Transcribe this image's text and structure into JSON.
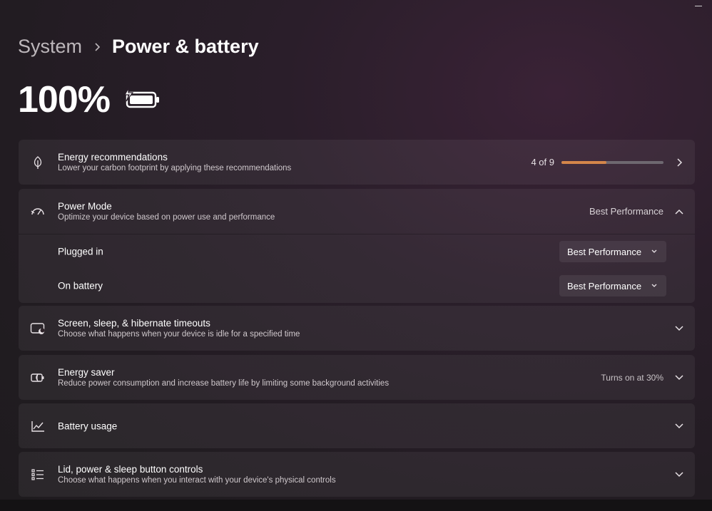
{
  "breadcrumb": {
    "parent": "System",
    "current": "Power & battery"
  },
  "battery": {
    "percent_label": "100%",
    "icon": "battery-charging-icon"
  },
  "energy_recommendations": {
    "title": "Energy recommendations",
    "desc": "Lower your carbon footprint by applying these recommendations",
    "progress_label": "4 of 9",
    "progress_fraction": 0.444,
    "accent": "#d4864a",
    "icon": "leaf-icon"
  },
  "power_mode": {
    "title": "Power Mode",
    "desc": "Optimize your device based on power use and performance",
    "value": "Best Performance",
    "icon": "speedometer-icon",
    "plugged_in": {
      "label": "Plugged in",
      "value": "Best Performance"
    },
    "on_battery": {
      "label": "On battery",
      "value": "Best Performance"
    }
  },
  "screen_sleep": {
    "title": "Screen, sleep, & hibernate timeouts",
    "desc": "Choose what happens when your device is idle for a specified time",
    "icon": "screen-sleep-icon"
  },
  "energy_saver": {
    "title": "Energy saver",
    "desc": "Reduce power consumption and increase battery life by limiting some background activities",
    "status": "Turns on at 30%",
    "icon": "energy-saver-icon"
  },
  "battery_usage": {
    "title": "Battery usage",
    "icon": "line-chart-icon"
  },
  "lid_controls": {
    "title": "Lid, power & sleep button controls",
    "desc": "Choose what happens when you interact with your device's physical controls",
    "icon": "list-icon"
  }
}
